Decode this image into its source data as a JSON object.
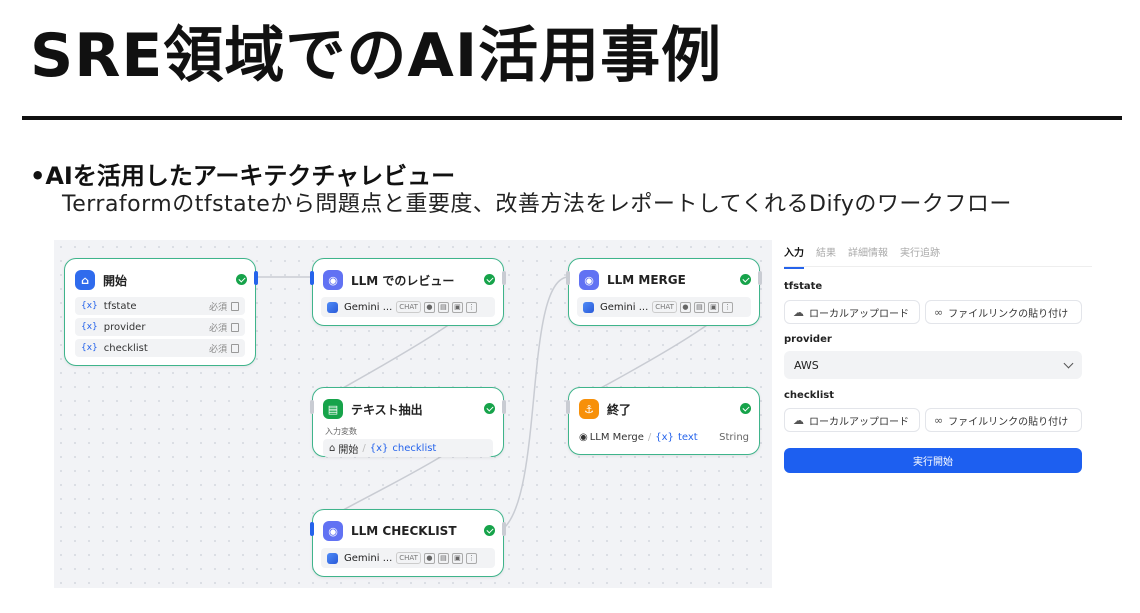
{
  "slide": {
    "title": "SRE領域でのAI活用事例",
    "bullet": "•AIを活用したアーキテクチャレビュー",
    "subline": "Terraformのtfstateから問題点と重要度、改善方法をレポートしてくれるDifyのワークフロー"
  },
  "nodes": {
    "start": {
      "title": "開始",
      "icon": "home-icon",
      "vars": [
        {
          "symbol": "{x}",
          "name": "tfstate",
          "required": "必須"
        },
        {
          "symbol": "{x}",
          "name": "provider",
          "required": "必須"
        },
        {
          "symbol": "{x}",
          "name": "checklist",
          "required": "必須"
        }
      ]
    },
    "llm_review": {
      "title": "LLM でのレビュー",
      "model": "Gemini ...",
      "badge": "CHAT"
    },
    "text_extract": {
      "title": "テキスト抽出",
      "input_label": "入力変数",
      "input_source": "開始",
      "input_var_symbol": "{x}",
      "input_var": "checklist"
    },
    "llm_checklist": {
      "title": "LLM CHECKLIST",
      "model": "Gemini ...",
      "badge": "CHAT"
    },
    "llm_merge": {
      "title": "LLM MERGE",
      "model": "Gemini ...",
      "badge": "CHAT"
    },
    "end": {
      "title": "終了",
      "source": "LLM Merge",
      "var_symbol": "{x}",
      "var": "text",
      "type": "String"
    }
  },
  "panel": {
    "tabs": [
      "入力",
      "結果",
      "詳細情報",
      "実行追跡"
    ],
    "active_tab": "入力",
    "tfstate_label": "tfstate",
    "provider_label": "provider",
    "checklist_label": "checklist",
    "upload_label": "ローカルアップロード",
    "link_label": "ファイルリンクの貼り付け",
    "provider_value": "AWS",
    "run_label": "実行開始"
  },
  "colors": {
    "node_border": "#3fb48b",
    "accent": "#1d5ff0",
    "start_icon": "#2f6bed",
    "llm_icon": "#6172f3",
    "extract_icon": "#16a34a",
    "end_icon": "#f79009"
  }
}
